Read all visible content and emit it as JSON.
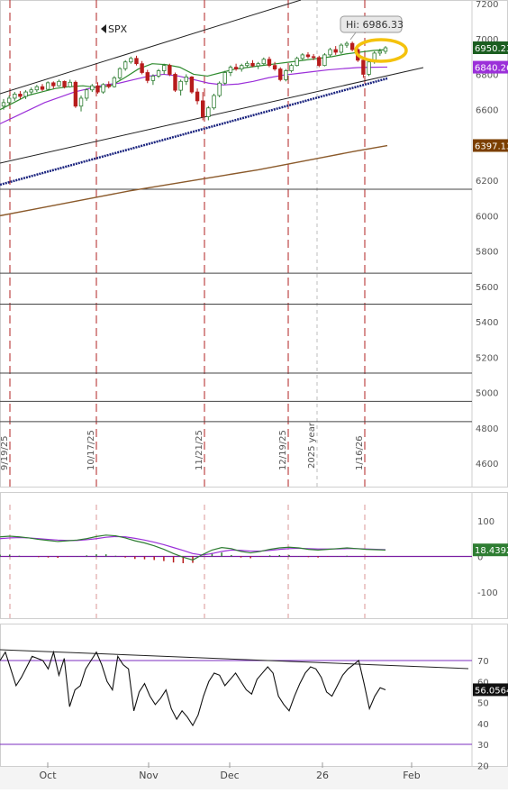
{
  "symbol": "SPX",
  "hi_label": "Hi: 6986.33",
  "colors": {
    "up": "#2e7d32",
    "down": "#b71c1c",
    "ma_short": "#2e8b2e",
    "ma_mid": "#9b30d9",
    "ma_long": "#8b5a2b",
    "ma_blue": "#1a237e",
    "cycle_line": "#b22222",
    "highlight": "#f4c20d",
    "tag_last": "#1b5e20",
    "tag_ma_mid": "#9b30d9",
    "tag_ma_long": "#7b3f00",
    "tag_macd": "#2e7d32",
    "hline_purple": "#7b2cbf"
  },
  "chart_data": [
    {
      "type": "candlestick",
      "title": "SPX",
      "ylim": [
        4480,
        7200
      ],
      "y_ticks": [
        4600,
        4800,
        5000,
        5200,
        5400,
        5600,
        5800,
        6000,
        6200,
        6400,
        6600,
        6800,
        7000,
        7200
      ],
      "last_price": "6950.23",
      "ma_mid_value": "6840.26",
      "ma_long_value": "6397.13",
      "hi_value": 6986.33,
      "horizontal_levels": [
        6150,
        5675,
        5500,
        5110,
        4950,
        4835
      ],
      "cycle_date_labels": [
        "9/19/25",
        "10/17/25",
        "11/21/25",
        "12/19/25",
        "1/16/26"
      ],
      "year_marker_label": "2025 year",
      "candles": [
        {
          "o": 6620,
          "h": 6660,
          "l": 6600,
          "c": 6640
        },
        {
          "o": 6640,
          "h": 6680,
          "l": 6625,
          "c": 6665
        },
        {
          "o": 6665,
          "h": 6700,
          "l": 6650,
          "c": 6688
        },
        {
          "o": 6688,
          "h": 6705,
          "l": 6660,
          "c": 6675
        },
        {
          "o": 6675,
          "h": 6710,
          "l": 6660,
          "c": 6700
        },
        {
          "o": 6700,
          "h": 6725,
          "l": 6685,
          "c": 6712
        },
        {
          "o": 6712,
          "h": 6740,
          "l": 6700,
          "c": 6730
        },
        {
          "o": 6730,
          "h": 6745,
          "l": 6705,
          "c": 6715
        },
        {
          "o": 6715,
          "h": 6760,
          "l": 6710,
          "c": 6752
        },
        {
          "o": 6752,
          "h": 6760,
          "l": 6720,
          "c": 6735
        },
        {
          "o": 6735,
          "h": 6770,
          "l": 6730,
          "c": 6760
        },
        {
          "o": 6760,
          "h": 6765,
          "l": 6720,
          "c": 6730
        },
        {
          "o": 6730,
          "h": 6770,
          "l": 6725,
          "c": 6755
        },
        {
          "o": 6755,
          "h": 6765,
          "l": 6610,
          "c": 6620
        },
        {
          "o": 6620,
          "h": 6680,
          "l": 6590,
          "c": 6665
        },
        {
          "o": 6665,
          "h": 6720,
          "l": 6650,
          "c": 6712
        },
        {
          "o": 6712,
          "h": 6745,
          "l": 6700,
          "c": 6735
        },
        {
          "o": 6735,
          "h": 6755,
          "l": 6690,
          "c": 6700
        },
        {
          "o": 6700,
          "h": 6750,
          "l": 6690,
          "c": 6742
        },
        {
          "o": 6742,
          "h": 6760,
          "l": 6720,
          "c": 6730
        },
        {
          "o": 6730,
          "h": 6790,
          "l": 6725,
          "c": 6780
        },
        {
          "o": 6780,
          "h": 6840,
          "l": 6770,
          "c": 6832
        },
        {
          "o": 6832,
          "h": 6880,
          "l": 6820,
          "c": 6870
        },
        {
          "o": 6870,
          "h": 6900,
          "l": 6860,
          "c": 6890
        },
        {
          "o": 6890,
          "h": 6905,
          "l": 6850,
          "c": 6860
        },
        {
          "o": 6860,
          "h": 6875,
          "l": 6800,
          "c": 6810
        },
        {
          "o": 6810,
          "h": 6825,
          "l": 6750,
          "c": 6765
        },
        {
          "o": 6765,
          "h": 6800,
          "l": 6740,
          "c": 6790
        },
        {
          "o": 6790,
          "h": 6830,
          "l": 6780,
          "c": 6820
        },
        {
          "o": 6820,
          "h": 6860,
          "l": 6800,
          "c": 6850
        },
        {
          "o": 6850,
          "h": 6860,
          "l": 6790,
          "c": 6800
        },
        {
          "o": 6800,
          "h": 6810,
          "l": 6700,
          "c": 6710
        },
        {
          "o": 6710,
          "h": 6770,
          "l": 6680,
          "c": 6760
        },
        {
          "o": 6760,
          "h": 6800,
          "l": 6740,
          "c": 6785
        },
        {
          "o": 6785,
          "h": 6790,
          "l": 6690,
          "c": 6700
        },
        {
          "o": 6700,
          "h": 6720,
          "l": 6630,
          "c": 6650
        },
        {
          "o": 6650,
          "h": 6700,
          "l": 6540,
          "c": 6560
        },
        {
          "o": 6560,
          "h": 6620,
          "l": 6540,
          "c": 6610
        },
        {
          "o": 6610,
          "h": 6690,
          "l": 6600,
          "c": 6680
        },
        {
          "o": 6680,
          "h": 6760,
          "l": 6670,
          "c": 6750
        },
        {
          "o": 6750,
          "h": 6820,
          "l": 6740,
          "c": 6810
        },
        {
          "o": 6810,
          "h": 6850,
          "l": 6790,
          "c": 6840
        },
        {
          "o": 6840,
          "h": 6860,
          "l": 6820,
          "c": 6830
        },
        {
          "o": 6830,
          "h": 6860,
          "l": 6815,
          "c": 6850
        },
        {
          "o": 6850,
          "h": 6875,
          "l": 6840,
          "c": 6862
        },
        {
          "o": 6862,
          "h": 6880,
          "l": 6840,
          "c": 6848
        },
        {
          "o": 6848,
          "h": 6870,
          "l": 6830,
          "c": 6860
        },
        {
          "o": 6860,
          "h": 6895,
          "l": 6850,
          "c": 6885
        },
        {
          "o": 6885,
          "h": 6900,
          "l": 6840,
          "c": 6850
        },
        {
          "o": 6850,
          "h": 6870,
          "l": 6820,
          "c": 6830
        },
        {
          "o": 6830,
          "h": 6840,
          "l": 6760,
          "c": 6770
        },
        {
          "o": 6770,
          "h": 6830,
          "l": 6760,
          "c": 6820
        },
        {
          "o": 6820,
          "h": 6860,
          "l": 6810,
          "c": 6850
        },
        {
          "o": 6850,
          "h": 6900,
          "l": 6845,
          "c": 6890
        },
        {
          "o": 6890,
          "h": 6920,
          "l": 6880,
          "c": 6910
        },
        {
          "o": 6910,
          "h": 6925,
          "l": 6890,
          "c": 6900
        },
        {
          "o": 6900,
          "h": 6915,
          "l": 6880,
          "c": 6895
        },
        {
          "o": 6895,
          "h": 6905,
          "l": 6840,
          "c": 6850
        },
        {
          "o": 6850,
          "h": 6920,
          "l": 6845,
          "c": 6910
        },
        {
          "o": 6910,
          "h": 6950,
          "l": 6900,
          "c": 6940
        },
        {
          "o": 6940,
          "h": 6960,
          "l": 6910,
          "c": 6925
        },
        {
          "o": 6925,
          "h": 6975,
          "l": 6915,
          "c": 6965
        },
        {
          "o": 6965,
          "h": 6986,
          "l": 6950,
          "c": 6975
        },
        {
          "o": 6975,
          "h": 6985,
          "l": 6930,
          "c": 6940
        },
        {
          "o": 6940,
          "h": 6950,
          "l": 6870,
          "c": 6880
        },
        {
          "o": 6880,
          "h": 6890,
          "l": 6780,
          "c": 6800
        },
        {
          "o": 6800,
          "h": 6880,
          "l": 6790,
          "c": 6870
        },
        {
          "o": 6870,
          "h": 6930,
          "l": 6860,
          "c": 6920
        },
        {
          "o": 6920,
          "h": 6945,
          "l": 6905,
          "c": 6930
        },
        {
          "o": 6930,
          "h": 6960,
          "l": 6915,
          "c": 6950
        }
      ],
      "ma_short": [
        6600,
        6640,
        6680,
        6700,
        6720,
        6730,
        6735,
        6725,
        6735,
        6780,
        6830,
        6860,
        6855,
        6840,
        6800,
        6790,
        6810,
        6830,
        6840,
        6850,
        6860,
        6870,
        6880,
        6890,
        6900,
        6915,
        6925,
        6935,
        6940
      ],
      "ma_mid": [
        6520,
        6560,
        6600,
        6640,
        6670,
        6700,
        6720,
        6740,
        6750,
        6770,
        6790,
        6800,
        6790,
        6770,
        6750,
        6740,
        6745,
        6760,
        6780,
        6795,
        6805,
        6815,
        6825,
        6832,
        6838,
        6840,
        6841
      ],
      "ma_long": [
        6000,
        6035,
        6070,
        6105,
        6140,
        6170,
        6200,
        6230,
        6260,
        6295,
        6330,
        6365,
        6397
      ]
    },
    {
      "type": "macd",
      "ylim": [
        -160,
        160
      ],
      "y_ticks": [
        100,
        0,
        -100
      ],
      "last_value": "18.4392",
      "macd": [
        55,
        57,
        55,
        52,
        48,
        45,
        42,
        44,
        46,
        50,
        56,
        60,
        58,
        52,
        44,
        38,
        30,
        20,
        8,
        -2,
        -10,
        5,
        18,
        25,
        22,
        14,
        10,
        14,
        20,
        24,
        26,
        24,
        20,
        18,
        20,
        22,
        24,
        22,
        20,
        19,
        18
      ],
      "signal": [
        50,
        52,
        53,
        52,
        50,
        48,
        46,
        45,
        45,
        47,
        50,
        54,
        56,
        55,
        51,
        46,
        40,
        33,
        25,
        17,
        8,
        4,
        8,
        14,
        18,
        17,
        15,
        15,
        17,
        20,
        22,
        23,
        22,
        21,
        21,
        21,
        22,
        22,
        21,
        20,
        19
      ],
      "histogram": [
        5,
        5,
        2,
        0,
        -2,
        -3,
        -4,
        -1,
        1,
        3,
        6,
        6,
        2,
        -3,
        -7,
        -8,
        -10,
        -13,
        -17,
        -19,
        -18,
        1,
        10,
        11,
        4,
        -3,
        -5,
        -1,
        3,
        4,
        4,
        1,
        -2,
        -3,
        -1,
        1,
        2,
        0,
        -1,
        -1,
        -1
      ]
    },
    {
      "type": "rsi",
      "ylim": [
        20,
        80
      ],
      "y_ticks": [
        70,
        60,
        50,
        40,
        30,
        20
      ],
      "last_value": "56.0564",
      "overbought": 70,
      "oversold": 30,
      "values": [
        70,
        74,
        66,
        58,
        62,
        67,
        72,
        71,
        70,
        66,
        74,
        63,
        71,
        48,
        56,
        58,
        66,
        70,
        74,
        68,
        60,
        56,
        72,
        68,
        66,
        46,
        55,
        59,
        53,
        49,
        52,
        56,
        47,
        42,
        46,
        43,
        39,
        44,
        53,
        60,
        64,
        63,
        58,
        61,
        64,
        60,
        56,
        54,
        61,
        64,
        67,
        64,
        53,
        49,
        46,
        53,
        59,
        64,
        67,
        66,
        62,
        55,
        53,
        58,
        63,
        66,
        68,
        70,
        59,
        47,
        53,
        57,
        56
      ]
    }
  ],
  "x_axis": {
    "month_labels": [
      "Oct",
      "Nov",
      "Dec",
      "26",
      "Feb"
    ]
  }
}
